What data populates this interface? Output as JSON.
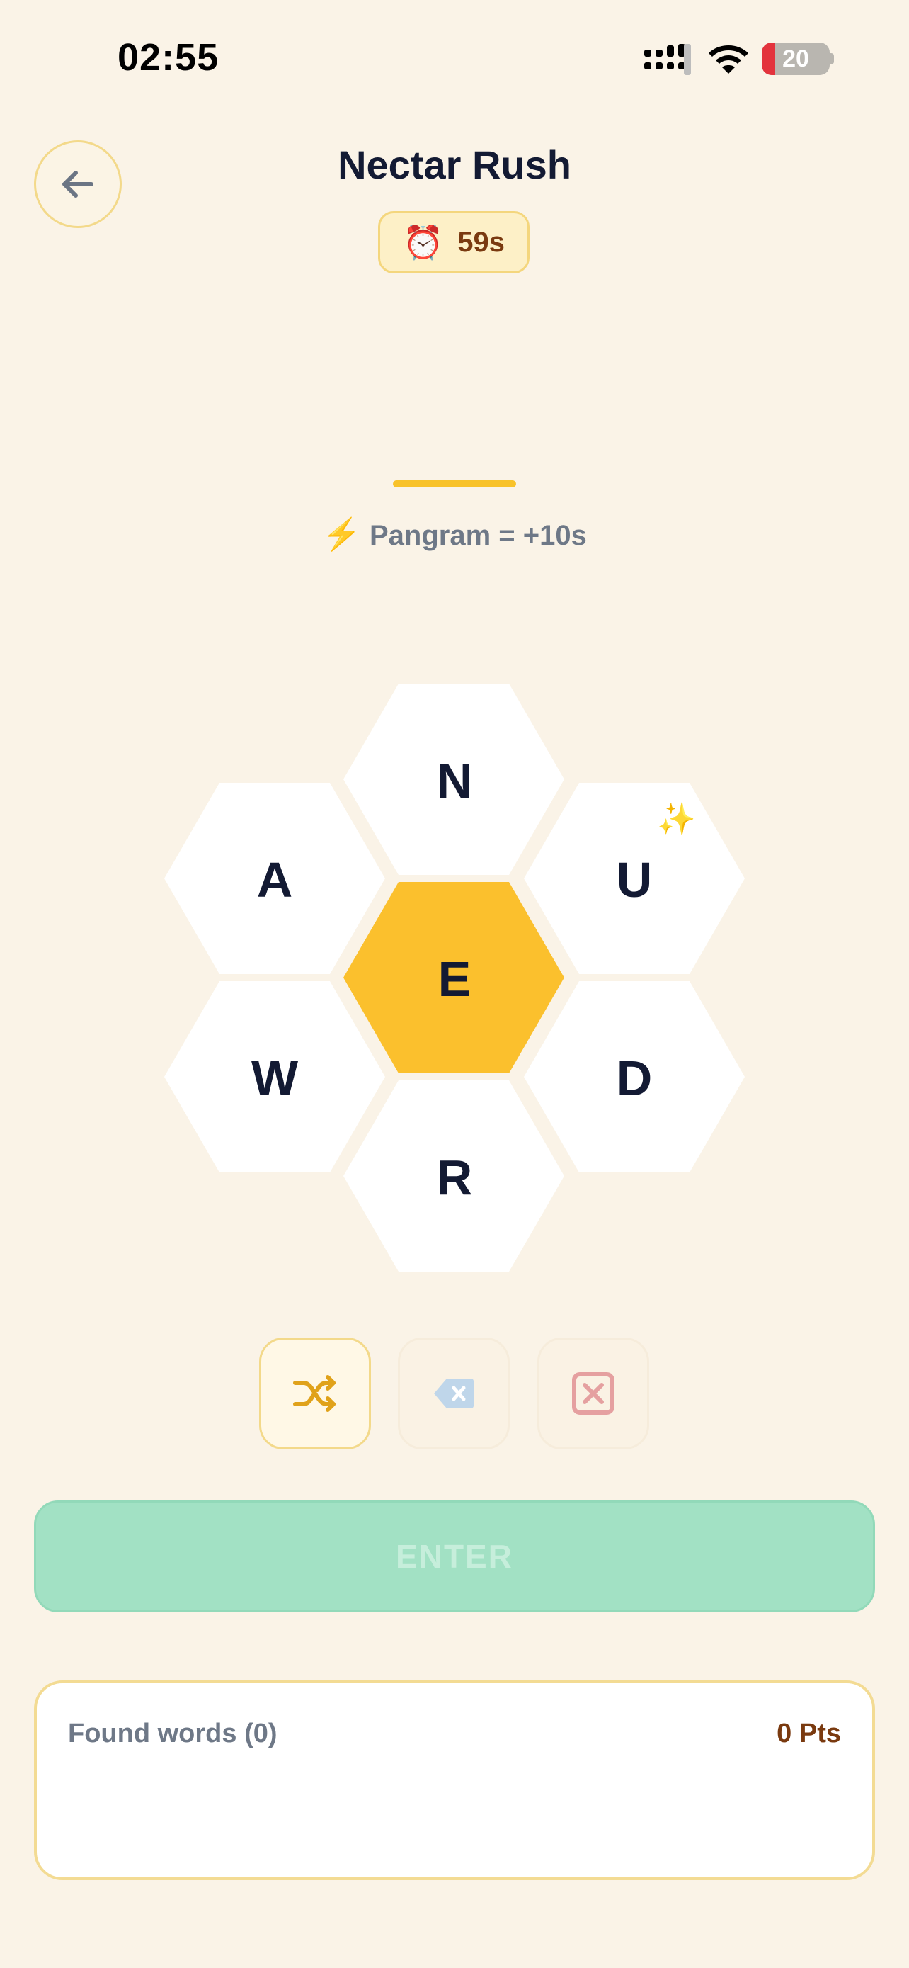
{
  "status_bar": {
    "time": "02:55",
    "battery": "20",
    "battery_level": 0.2
  },
  "header": {
    "title": "Nectar Rush",
    "back_icon": "arrow-left-icon"
  },
  "timer": {
    "icon": "alarm-clock-icon",
    "glyph": "⏰",
    "value": "59s"
  },
  "hint": {
    "icon": "lightning-icon",
    "glyph": "⚡",
    "text": "Pangram = +10s"
  },
  "hive": {
    "center": "E",
    "outer": {
      "top": "N",
      "upper_left": "A",
      "upper_right": "U",
      "lower_left": "W",
      "lower_right": "D",
      "bottom": "R"
    },
    "sparkle": "✨"
  },
  "actions": {
    "shuffle_icon": "shuffle-icon",
    "delete_icon": "backspace-icon",
    "clear_icon": "clear-icon"
  },
  "enter": {
    "label": "ENTER"
  },
  "found_words": {
    "label": "Found words (0)",
    "points": "0 Pts"
  },
  "colors": {
    "background": "#FAF3E7",
    "center_hex": "#FBC02D",
    "enter": "#A2E1C4",
    "accent": "#F3D98A"
  }
}
